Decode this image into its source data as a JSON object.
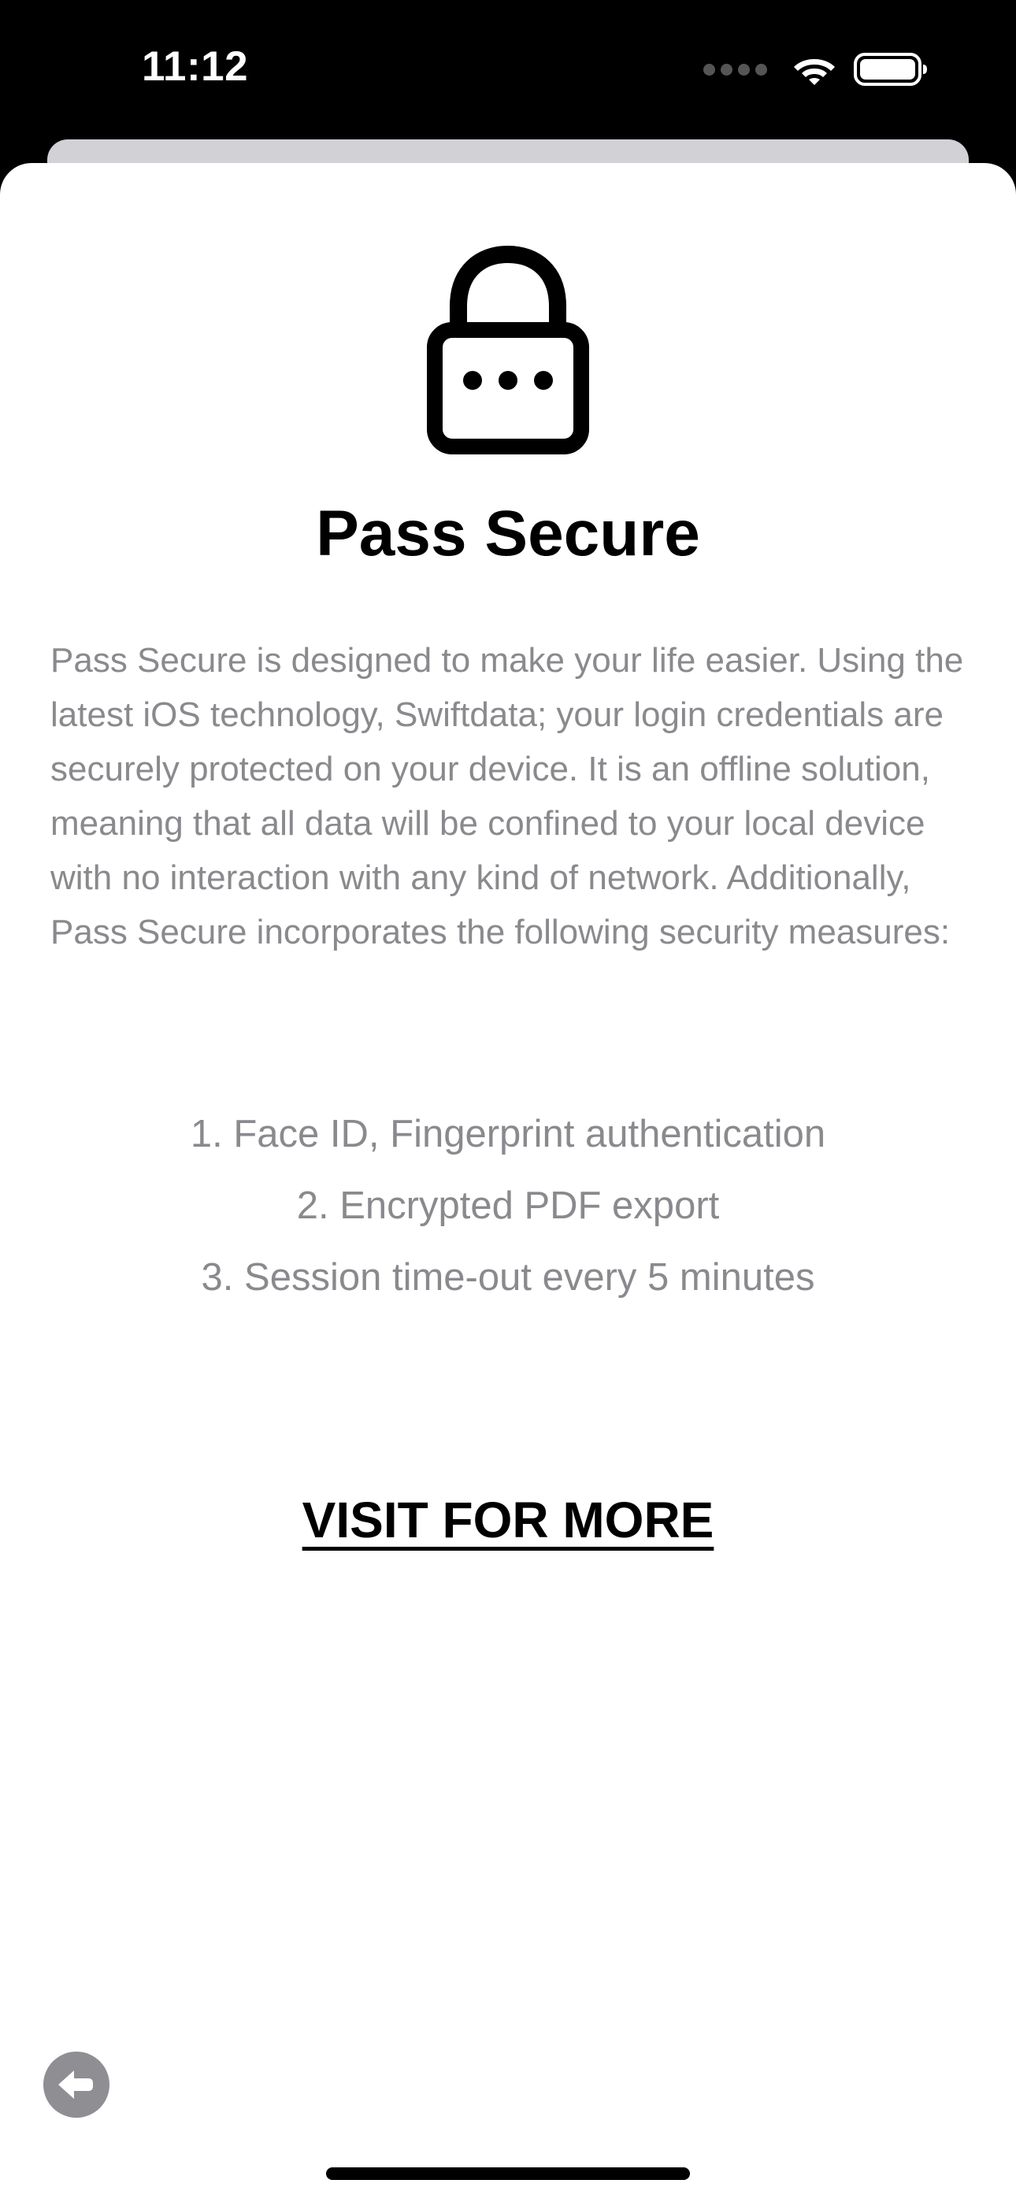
{
  "status_bar": {
    "time": "11:12",
    "icons": [
      "cellular-signal-icon",
      "wifi-icon",
      "battery-icon"
    ]
  },
  "sheet": {
    "icon": "lock-ellipsis-icon",
    "title": "Pass Secure",
    "description": "Pass Secure is designed to make your life easier. Using the latest iOS technology, Swiftdata; your login credentials are securely protected on your device. It is an offline solution, meaning that all data will be confined to your local device with no interaction with any kind of network. Additionally, Pass Secure incorporates the following security measures:",
    "features": [
      "1. Face ID, Fingerprint authentication",
      "2. Encrypted PDF export",
      "3. Session time-out every 5 minutes"
    ],
    "visit_link": "VISIT FOR MORE"
  },
  "back_button": {
    "icon": "back-arrow-icon"
  },
  "colors": {
    "title": "#000000",
    "body_text": "#8a8a8e",
    "sheet_background": "#ffffff",
    "back_button": "#8e8e93"
  }
}
